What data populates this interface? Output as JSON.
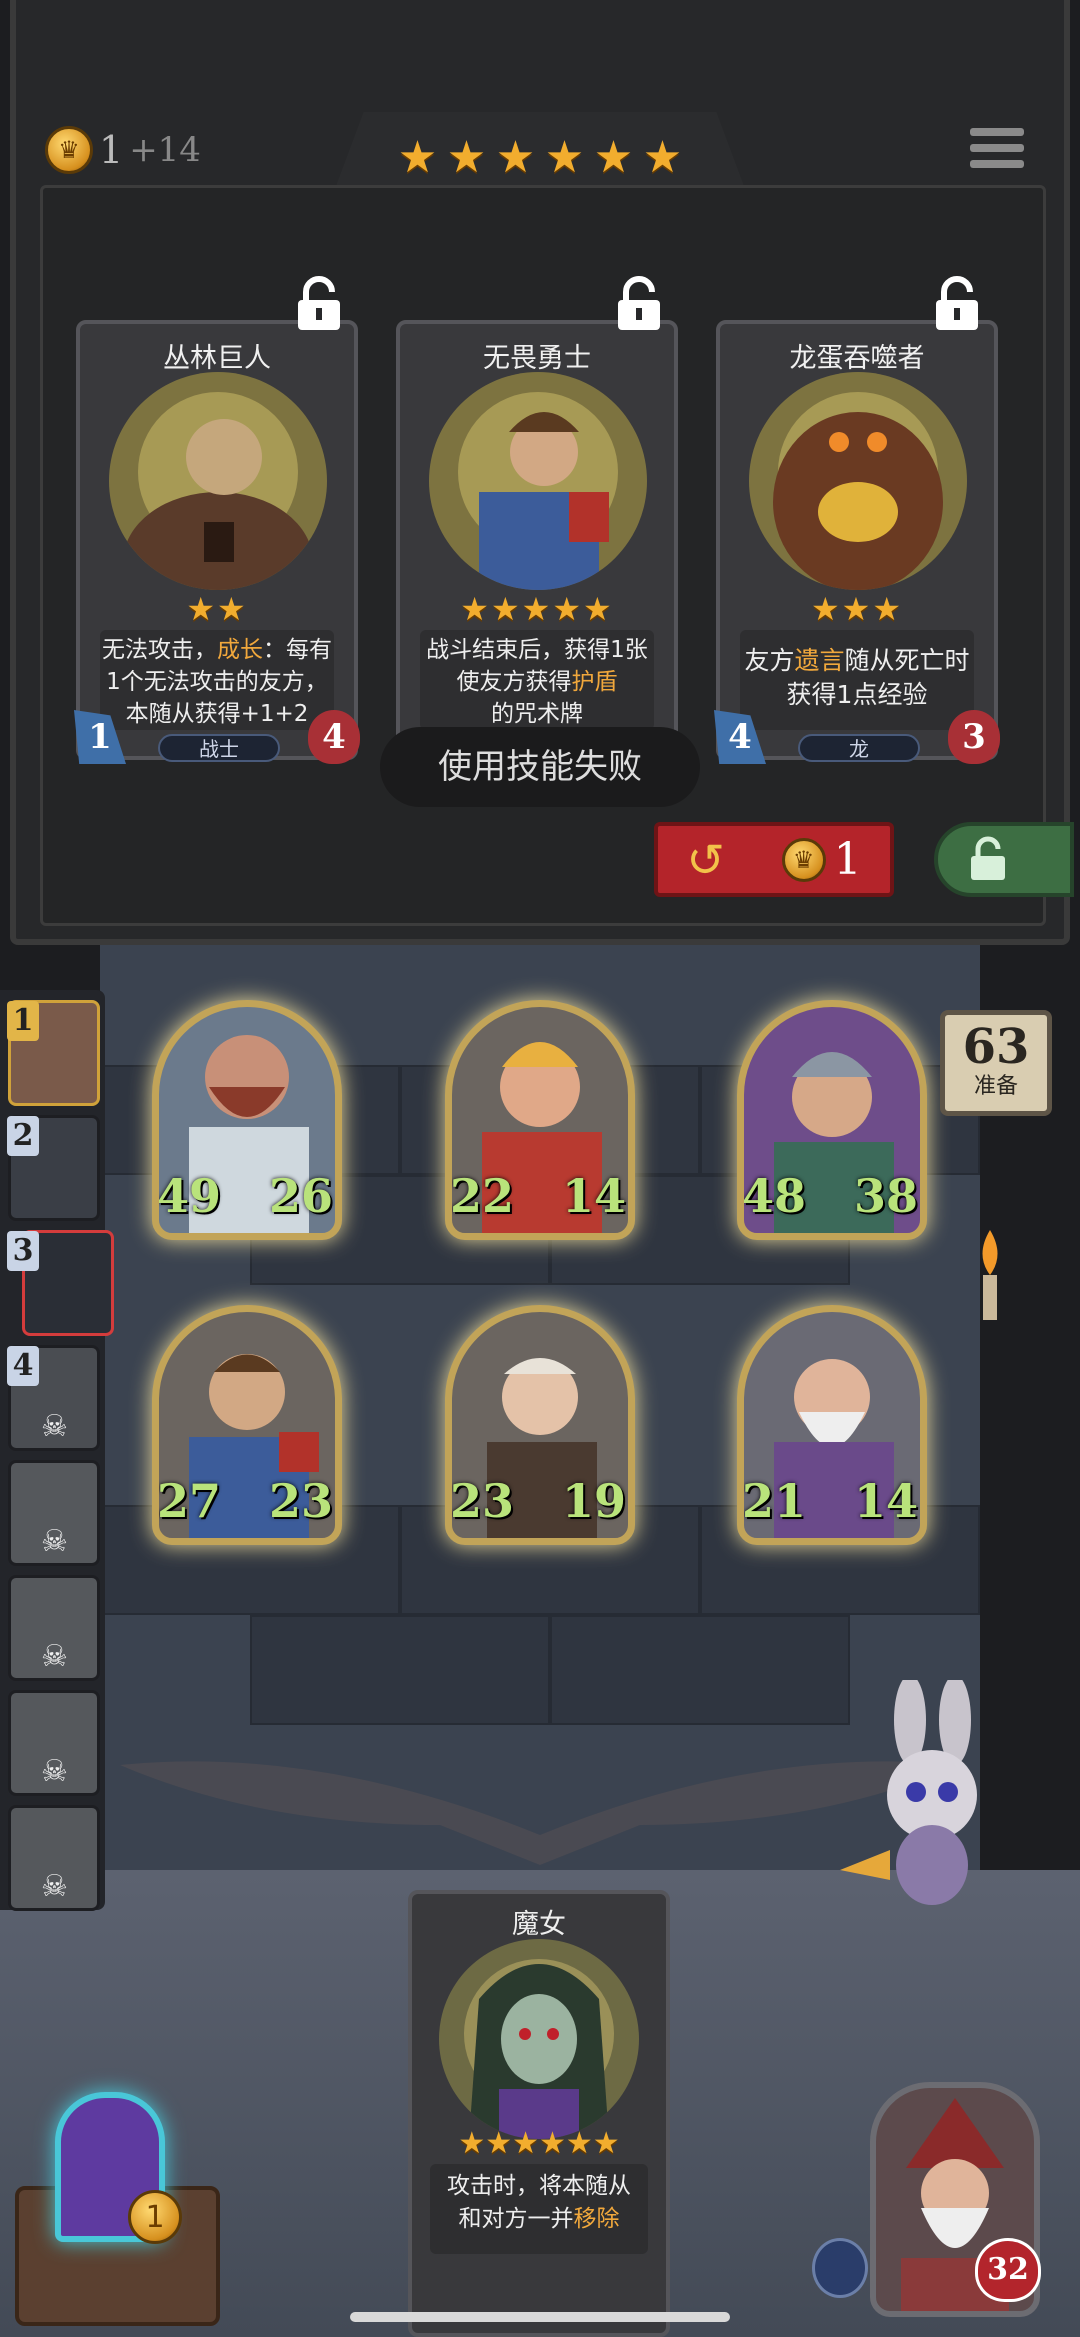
{
  "shop": {
    "gold": "1",
    "gold_income": "+14",
    "tavern_stars": [
      "★",
      "★",
      "★",
      "★",
      "★",
      "★"
    ],
    "cards": [
      {
        "name": "丛林巨人",
        "stars": "★★",
        "desc_a": "无法攻击，",
        "desc_b": "成长",
        "desc_c": "：每有",
        "desc_d": "1个无法攻击的友方，",
        "desc_e": "本随从获得+1+2",
        "attack": "1",
        "health": "4",
        "tribe": "战士"
      },
      {
        "name": "无畏勇士",
        "stars": "★★★★★",
        "desc_a": "战斗结束后，获得1张",
        "desc_b": "使友方获得",
        "desc_c": "护盾",
        "desc_d": "的咒术牌",
        "attack": "",
        "health": "",
        "tribe": ""
      },
      {
        "name": "龙蛋吞噬者",
        "stars": "★★★",
        "desc_a": "友方",
        "desc_b": "遗言",
        "desc_c": "随从死亡时",
        "desc_d": "获得1点经验",
        "attack": "4",
        "health": "3",
        "tribe": "龙"
      }
    ],
    "toast": "使用技能失败",
    "refresh_cost": "1"
  },
  "board": {
    "ready_count": "63",
    "ready_label": "准备",
    "minions": [
      {
        "attack": "49",
        "health": "26"
      },
      {
        "attack": "22",
        "health": "14"
      },
      {
        "attack": "48",
        "health": "38"
      },
      {
        "attack": "27",
        "health": "23"
      },
      {
        "attack": "23",
        "health": "19"
      },
      {
        "attack": "21",
        "health": "14"
      }
    ]
  },
  "players": [
    {
      "rank": "1",
      "status": "me"
    },
    {
      "rank": "2",
      "status": "alive"
    },
    {
      "rank": "3",
      "status": "hit"
    },
    {
      "rank": "4",
      "status": "alive"
    },
    {
      "rank": "",
      "status": "dead"
    },
    {
      "rank": "",
      "status": "dead"
    },
    {
      "rank": "",
      "status": "dead"
    },
    {
      "rank": "",
      "status": "dead"
    }
  ],
  "hand": {
    "name": "魔女",
    "stars": "★★★★★★",
    "desc_a": "攻击时，将本随从",
    "desc_b": "和对方一并",
    "desc_c": "移除"
  },
  "spell_cost": "1",
  "hero": {
    "health": "32"
  },
  "colors": {
    "star": "#f2ad2e",
    "highlight": "#f1a83c",
    "minion_stat": "#b9e37b",
    "refresh": "#b4242a",
    "freeze": "#3d6e43"
  }
}
